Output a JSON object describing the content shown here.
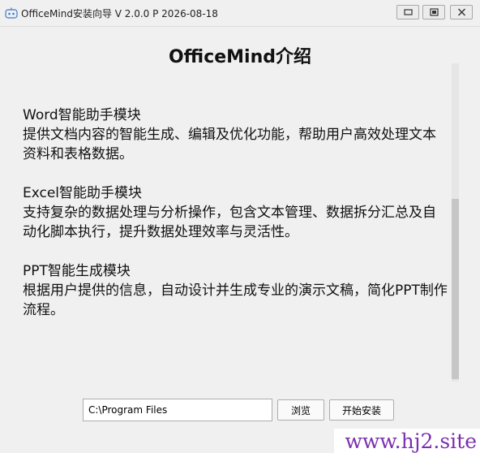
{
  "window": {
    "title": "OfficeMind安装向导  V 2.0.0  P 2026-08-18",
    "icons": {
      "app": "app-icon",
      "minimize": "minimize-icon",
      "restore": "restore-icon",
      "close": "close-icon"
    }
  },
  "main": {
    "heading": "OfficeMind介绍",
    "sections": [
      {
        "title": "Word智能助手模块",
        "desc": "提供文档内容的智能生成、编辑及优化功能，帮助用户高效处理文本资料和表格数据。"
      },
      {
        "title": "Excel智能助手模块",
        "desc": "支持复杂的数据处理与分析操作，包含文本管理、数据拆分汇总及自动化脚本执行，提升数据处理效率与灵活性。"
      },
      {
        "title": "PPT智能生成模块",
        "desc": "根据用户提供的信息，自动设计并生成专业的演示文稿，简化PPT制作流程。"
      }
    ]
  },
  "footer": {
    "path_value": "C:\\Program Files",
    "browse_label": "浏览",
    "install_label": "开始安装"
  },
  "watermark": "www.hj2.site"
}
